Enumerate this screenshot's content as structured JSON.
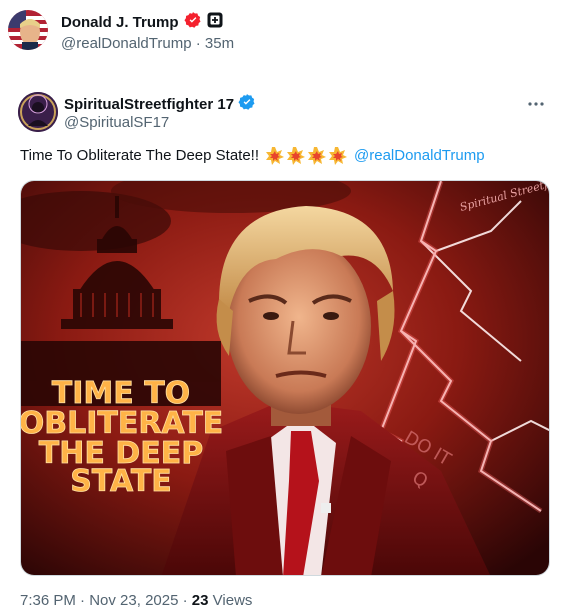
{
  "outer_author": {
    "display_name": "Donald J. Trump",
    "handle": "@realDonaldTrump",
    "age": "35m",
    "separator": "·"
  },
  "inner_author": {
    "display_name": "SpiritualStreetfighter 17",
    "handle": "@SpiritualSF17"
  },
  "tweet": {
    "text": "Time To Obliterate The Deep State!!",
    "emojis": [
      "collision-emoji",
      "collision-emoji",
      "collision-emoji",
      "collision-emoji"
    ],
    "mention": "@realDonaldTrump"
  },
  "media": {
    "overlay_text_lines": [
      "TIME TO",
      "OBLITERATE",
      "THE DEEP",
      "STATE"
    ],
    "signature": "Spiritual Streetfighter",
    "jacket_text_1": "DO IT",
    "jacket_text_2": "Q"
  },
  "footer": {
    "time": "7:36 PM",
    "date": "Nov 23, 2025",
    "separator": "·",
    "views_count": "23",
    "views_label": "Views"
  },
  "colors": {
    "verified_blue": "#1d9bf0",
    "mention_blue": "#1d9bf0",
    "affiliate_red": "#f4212e",
    "secondary_text": "#536471"
  }
}
